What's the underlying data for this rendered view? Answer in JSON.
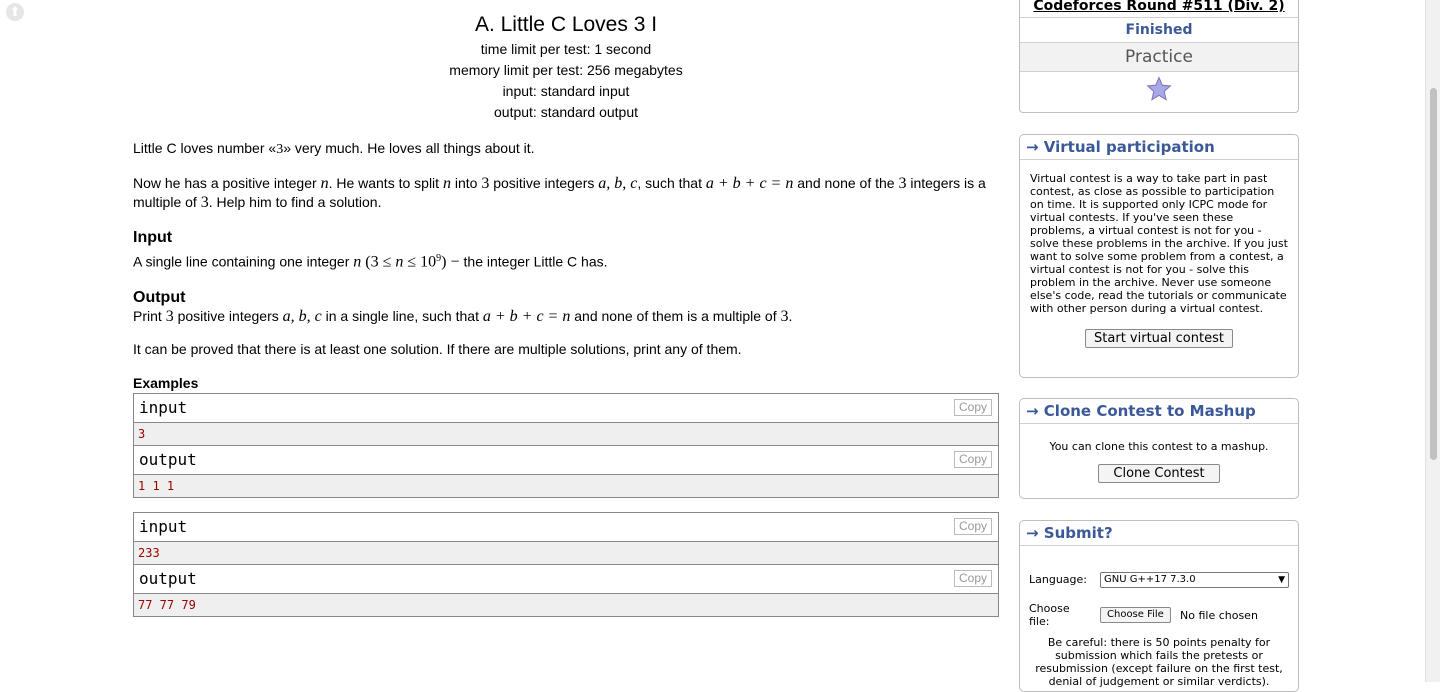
{
  "problem": {
    "title": "A. Little C Loves 3 I",
    "time_limit": "time limit per test: 1 second",
    "memory_limit": "memory limit per test: 256 megabytes",
    "input_spec": "input: standard input",
    "output_spec": "output: standard output",
    "legend_p1_a": "Little C loves number «",
    "legend_p1_num": "3",
    "legend_p1_b": "» very much. He loves all things about it.",
    "legend_p2_a": "Now he has a positive integer ",
    "legend_p2_n": "n",
    "legend_p2_b": ". He wants to split ",
    "legend_p2_n2": "n",
    "legend_p2_c": " into ",
    "legend_p2_3": "3",
    "legend_p2_d": " positive integers ",
    "legend_p2_abc": "a, b, c",
    "legend_p2_e": ", such that ",
    "legend_p2_eq": "a + b + c = n",
    "legend_p2_f": " and none of the ",
    "legend_p2_3b": "3",
    "legend_p2_g": " integers is a multiple of ",
    "legend_p2_3c": "3",
    "legend_p2_h": ". Help him to find a solution.",
    "input_title": "Input",
    "input_a": "A single line containing one integer ",
    "input_n": "n",
    "input_cons_a": " (3 ≤ ",
    "input_cons_n": "n",
    "input_cons_b": " ≤ 10",
    "input_cons_exp": "9",
    "input_cons_c": ") − ",
    "input_b": "the integer Little C has.",
    "output_title": "Output",
    "output_a": "Print ",
    "output_3": "3",
    "output_b": " positive integers ",
    "output_abc": "a, b, c",
    "output_c": " in a single line, such that ",
    "output_eq": "a + b + c = n",
    "output_d": " and none of them is a multiple of ",
    "output_3b": "3",
    "output_e": ".",
    "note": "It can be proved that there is at least one solution. If there are multiple solutions, print any of them.",
    "examples_title": "Examples",
    "examples": [
      {
        "input_label": "input",
        "input": "3",
        "output_label": "output",
        "output": "1 1 1"
      },
      {
        "input_label": "input",
        "input": "233",
        "output_label": "output",
        "output": "77 77 79"
      }
    ],
    "copy_label": "Copy"
  },
  "sidebar": {
    "contest_name": "Codeforces Round #511 (Div. 2)",
    "contest_status": "Finished",
    "practice_label": "Practice",
    "star_icon": "star-icon",
    "virtual": {
      "title": "→ Virtual participation",
      "text": "Virtual contest is a way to take part in past contest, as close as possible to participation on time. It is supported only ICPC mode for virtual contests. If you've seen these problems, a virtual contest is not for you - solve these problems in the archive. If you just want to solve some problem from a contest, a virtual contest is not for you - solve this problem in the archive. Never use someone else's code, read the tutorials or communicate with other person during a virtual contest.",
      "button": "Start virtual contest"
    },
    "clone": {
      "title": "→ Clone Contest to Mashup",
      "text": "You can clone this contest to a mashup.",
      "button": "Clone Contest"
    },
    "submit": {
      "title": "→ Submit?",
      "language_label": "Language:",
      "language_value": "GNU G++17 7.3.0",
      "choose_label": "Choose file:",
      "choose_button": "Choose File",
      "no_file": "No file chosen",
      "warning": "Be careful: there is 50 points penalty for submission which fails the pretests or resubmission (except failure on the first test, denial of judgement or similar verdicts)."
    }
  },
  "colors": {
    "link_blue": "#3b5998",
    "example_red": "#9b0000",
    "border": "#888888"
  }
}
